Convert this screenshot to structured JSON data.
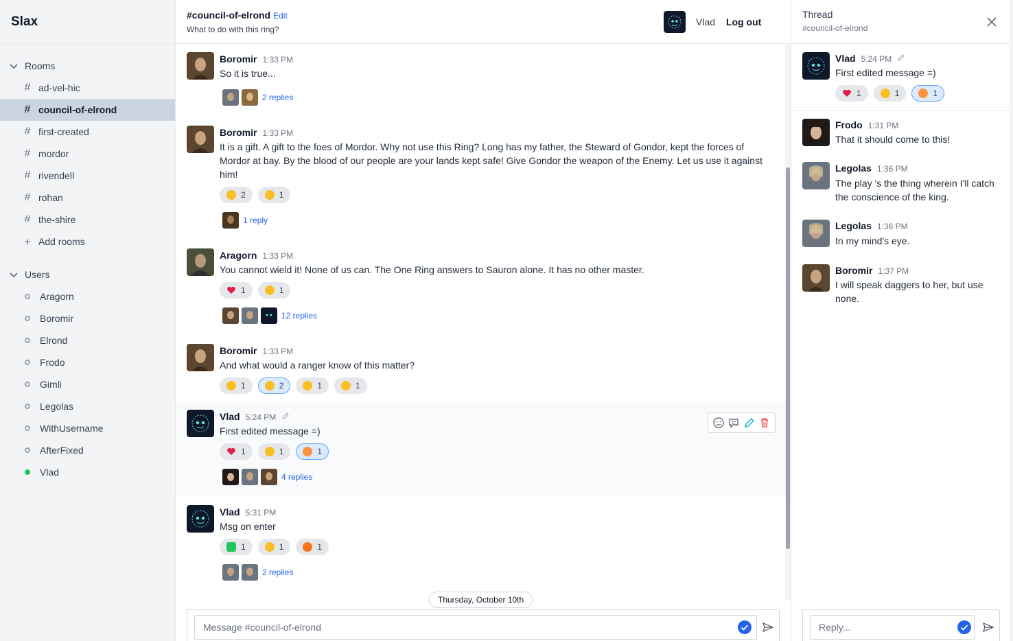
{
  "app": {
    "name": "Slax"
  },
  "sidebar": {
    "rooms_heading": "Rooms",
    "rooms": [
      {
        "label": "ad-vel-hic"
      },
      {
        "label": "council-of-elrond",
        "active": true
      },
      {
        "label": "first-created"
      },
      {
        "label": "mordor"
      },
      {
        "label": "rivendell"
      },
      {
        "label": "rohan"
      },
      {
        "label": "the-shire"
      }
    ],
    "add_rooms": "Add rooms",
    "users_heading": "Users",
    "users": [
      {
        "label": "Aragorn",
        "online": false
      },
      {
        "label": "Boromir",
        "online": false
      },
      {
        "label": "Elrond",
        "online": false
      },
      {
        "label": "Frodo",
        "online": false
      },
      {
        "label": "Gimli",
        "online": false
      },
      {
        "label": "Legolas",
        "online": false
      },
      {
        "label": "WithUsername",
        "online": false
      },
      {
        "label": "AfterFixed",
        "online": false
      },
      {
        "label": "Vlad",
        "online": true
      }
    ]
  },
  "header": {
    "room_title": "#council-of-elrond",
    "edit_label": "Edit",
    "topic": "What to do with this ring?",
    "current_user": "Vlad",
    "logout_label": "Log out"
  },
  "messages": [
    {
      "author": "Boromir",
      "time": "1:33 PM",
      "text": "So it is true...",
      "replies": "2 replies"
    },
    {
      "author": "Boromir",
      "time": "1:33 PM",
      "text": "It is a gift. A gift to the foes of Mordor. Why not use this Ring? Long has my father, the Steward of Gondor, kept the forces of Mordor at bay. By the blood of our people are your lands kept safe! Give Gondor the weapon of the Enemy. Let us use it against him!",
      "reactions": [
        "2",
        "1"
      ],
      "replies": "1 reply"
    },
    {
      "author": "Aragorn",
      "time": "1:33 PM",
      "text": "You cannot wield it! None of us can. The One Ring answers to Sauron alone. It has no other master.",
      "reactions": [
        "1",
        "1"
      ],
      "replies": "12 replies"
    },
    {
      "author": "Boromir",
      "time": "1:33 PM",
      "text": "And what would a ranger know of this matter?",
      "reactions": [
        "1",
        "2",
        "1",
        "1"
      ]
    },
    {
      "author": "Vlad",
      "time": "5:24 PM",
      "text": "First edited message =)",
      "reactions": [
        "1",
        "1",
        "1"
      ],
      "replies": "4 replies"
    },
    {
      "author": "Vlad",
      "time": "5:31 PM",
      "text": "Msg on enter",
      "reactions": [
        "1",
        "1",
        "1"
      ],
      "replies": "2 replies"
    }
  ],
  "date_divider": "Thursday, October 10th",
  "composer": {
    "placeholder": "Message #council-of-elrond"
  },
  "thread": {
    "title": "Thread",
    "subtitle": "#council-of-elrond",
    "parent": {
      "author": "Vlad",
      "time": "5:24 PM",
      "text": "First edited message =)",
      "reactions": [
        "1",
        "1",
        "1"
      ]
    },
    "replies": [
      {
        "author": "Frodo",
        "time": "1:31 PM",
        "text": "That it should come to this!"
      },
      {
        "author": "Legolas",
        "time": "1:36 PM",
        "text": "The play 's the thing wherein I'll catch the conscience of the king."
      },
      {
        "author": "Legolas",
        "time": "1:36 PM",
        "text": "In my mind's eye."
      },
      {
        "author": "Boromir",
        "time": "1:37 PM",
        "text": "I will speak daggers to her, but use none."
      }
    ],
    "composer_placeholder": "Reply..."
  },
  "colors": {
    "accent": "#2563eb",
    "sidebar_bg": "#f3f4f6",
    "active_room": "#cbd5e1",
    "online": "#22c55e"
  }
}
